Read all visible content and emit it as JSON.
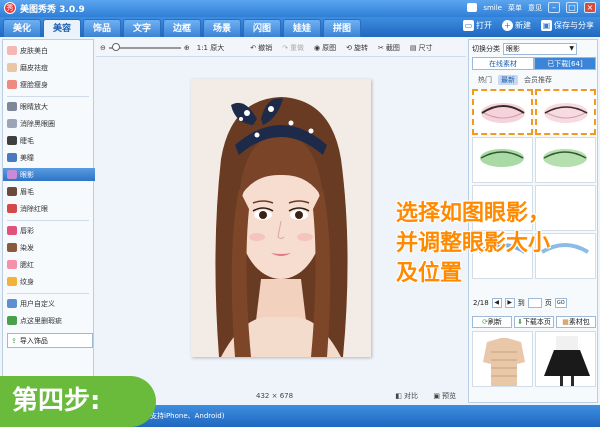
{
  "app": {
    "title": "美图秀秀 3.0.9",
    "logo_char": "秀",
    "user": "smile",
    "menu": "菜单",
    "feedback": "意见"
  },
  "tabs": [
    "美化",
    "美容",
    "饰品",
    "文字",
    "边框",
    "场景",
    "闪图",
    "娃娃",
    "拼图"
  ],
  "active_tab": 1,
  "actions": {
    "open": "打开",
    "new": "新建",
    "save": "保存与分享"
  },
  "sidebar": {
    "items": [
      {
        "label": "皮肤美白",
        "color": "#f4b7b3"
      },
      {
        "label": "磨皮祛痘",
        "color": "#e9c7a5"
      },
      {
        "label": "瘦脸瘦身",
        "color": "#f08a80"
      },
      {
        "label": "眼睛放大",
        "color": "#7d8799"
      },
      {
        "label": "消除黑眼圈",
        "color": "#9aa6b8"
      },
      {
        "label": "睫毛",
        "color": "#3f3f3f"
      },
      {
        "label": "美瞳",
        "color": "#4a78c2"
      },
      {
        "label": "眼影",
        "color": "#c98ad8"
      },
      {
        "label": "眉毛",
        "color": "#6a4a3a"
      },
      {
        "label": "消除红眼",
        "color": "#d44a4a"
      },
      {
        "label": "唇彩",
        "color": "#e0527a"
      },
      {
        "label": "染发",
        "color": "#8a5a3a"
      },
      {
        "label": "腮红",
        "color": "#f291a8"
      },
      {
        "label": "纹身",
        "color": "#f2b23a"
      },
      {
        "label": "用户自定义",
        "color": "#5a8fd0"
      },
      {
        "label": "点这里删瑕疵",
        "color": "#4aa04a"
      }
    ],
    "selected": 7,
    "import_label": "导入饰品"
  },
  "toolbar": {
    "original_size": "1:1 原大",
    "undo": "撤销",
    "redo": "重做",
    "original": "原图",
    "rotate": "旋转",
    "crop": "截图",
    "size": "尺寸",
    "zoom_level": 0.05
  },
  "status": {
    "width": "432",
    "times": "×",
    "height": "678",
    "compare": "对比",
    "preview": "预览"
  },
  "right": {
    "category_label": "切换分类",
    "category_value": "眼影",
    "tabs": [
      "在线素材",
      "已下载[64]"
    ],
    "filters": [
      "热门",
      "最新",
      "会员推荐"
    ],
    "active_filter": 1,
    "page_current": "2/18",
    "page_of": "页",
    "go": "GO",
    "refresh": "刷新",
    "download": "下载本页",
    "pack": "素材包"
  },
  "overlay": {
    "step": "第四步:",
    "instruction_lines": [
      "选择如图眼影，",
      "并调整眼影大小",
      "及位置"
    ]
  },
  "bottom": {
    "text": "支持iPhone、Android)"
  }
}
